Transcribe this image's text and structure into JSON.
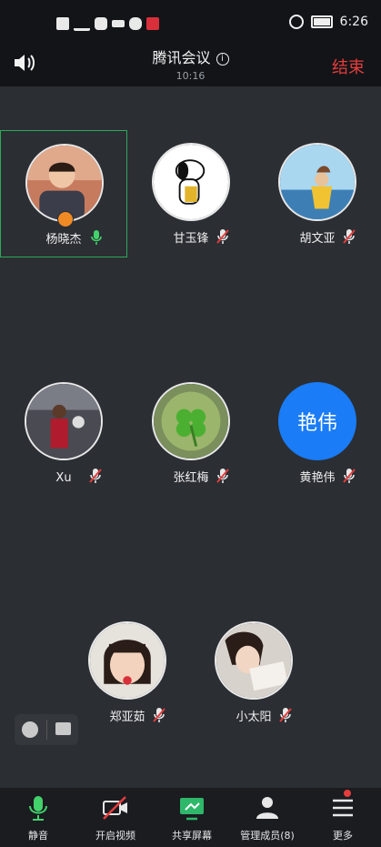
{
  "status_bar": {
    "time": "6:26"
  },
  "header": {
    "title": "腾讯会议",
    "time": "10:16",
    "end_label": "结束"
  },
  "participants": [
    {
      "name": "杨晓杰",
      "mic": "on",
      "host": true,
      "avatar": "photo-person"
    },
    {
      "name": "甘玉锋",
      "mic": "off",
      "avatar": "snoopy"
    },
    {
      "name": "胡文亚",
      "mic": "off",
      "avatar": "beach"
    },
    {
      "name": "Xu",
      "mic": "off",
      "avatar": "basketball"
    },
    {
      "name": "张红梅",
      "mic": "off",
      "avatar": "clover"
    },
    {
      "name": "黄艳伟",
      "mic": "off",
      "avatar": "text",
      "avatar_text": "艳伟"
    },
    {
      "name": "郑亚茹",
      "mic": "off",
      "avatar": "child"
    },
    {
      "name": "小太阳",
      "mic": "off",
      "avatar": "reading"
    }
  ],
  "toolbar": {
    "mute": "静音",
    "video": "开启视频",
    "share": "共享屏幕",
    "members": "管理成员(8)",
    "more": "更多"
  },
  "colors": {
    "accent_green": "#2ea85a",
    "end_red": "#e53d3d",
    "avatar_blue": "#1a7cf6"
  }
}
